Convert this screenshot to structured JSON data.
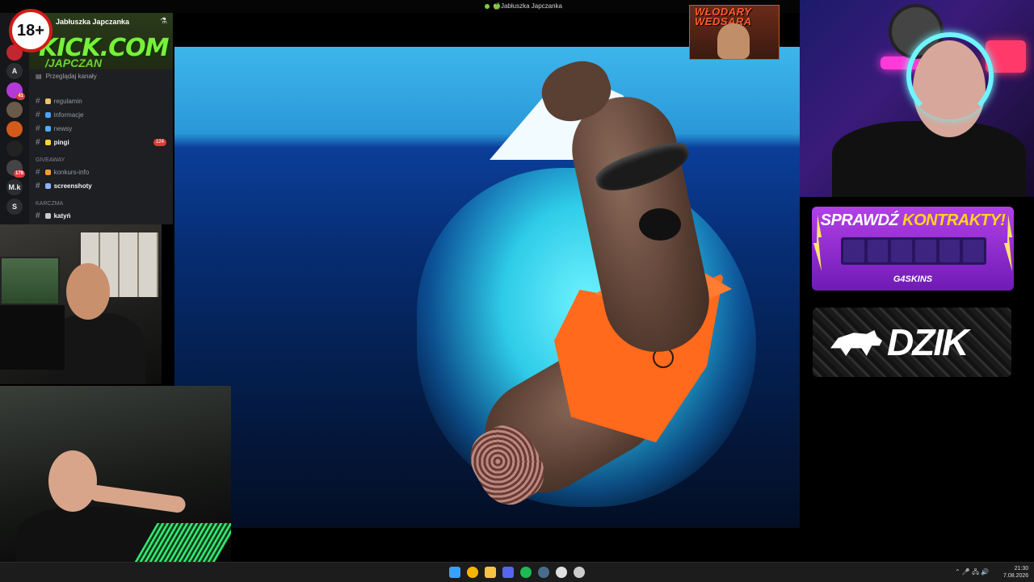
{
  "window": {
    "title": "🍏Jabłuszka Japczanka"
  },
  "age_badge": "18+",
  "discord": {
    "server_name": "Jabłuszka Japczanka",
    "banner_text": "KICK.COM",
    "banner_sub": "/JAPCZAN",
    "browse_label": "Przeglądaj kanały",
    "servers": [
      {
        "label": "",
        "icon": "pokeball-icon",
        "color": "#c2262e"
      },
      {
        "label": "A",
        "icon": "letter-avatar",
        "color": "#2b2d31"
      },
      {
        "label": "",
        "icon": "server-avatar",
        "color": "#b43ad8",
        "badge": "41"
      },
      {
        "label": "",
        "icon": "server-avatar",
        "color": "#6a5a4a"
      },
      {
        "label": "",
        "icon": "server-avatar",
        "color": "#d35a1a"
      },
      {
        "label": "",
        "icon": "server-avatar",
        "color": "#222"
      },
      {
        "label": "",
        "icon": "server-avatar",
        "color": "#444",
        "badge": "178"
      },
      {
        "label": "M.k",
        "icon": "letter-avatar",
        "color": "#2b2d31"
      },
      {
        "label": "S",
        "icon": "letter-avatar",
        "color": "#2b2d31"
      }
    ],
    "channels": [
      {
        "name": "regulamin",
        "emoji_color": "#e9c46a",
        "bold": false
      },
      {
        "name": "informacje",
        "emoji_color": "#4aa3ff",
        "bold": false
      },
      {
        "name": "newsy",
        "emoji_color": "#4ab0ff",
        "bold": false
      },
      {
        "name": "pingi",
        "emoji_color": "#ffd23a",
        "bold": true,
        "badge": "124"
      }
    ],
    "category_giveaway": "GIVEAWAY",
    "channels_giveaway": [
      {
        "name": "konkurs-info",
        "emoji_color": "#ff9b2e",
        "bold": false
      },
      {
        "name": "screenshoty",
        "emoji_color": "#8ab4ff",
        "bold": true
      }
    ],
    "category_karczma": "KARCZMA",
    "channels_karczma": [
      {
        "name": "katyń",
        "emoji_color": "#cccccc",
        "bold": true
      }
    ]
  },
  "overlays": {
    "emblem_text": "WŁODARY\nWEDSARA",
    "promo_title_main": "SPRAWDŹ ",
    "promo_title_accent": "KONTRAKTY!",
    "promo_brand": "G4SKINS",
    "dzik_text": "DZIK"
  },
  "taskbar": {
    "icons": [
      {
        "name": "windows-start-icon",
        "color": "#3aa0ff"
      },
      {
        "name": "chrome-icon",
        "color": "#f4b400"
      },
      {
        "name": "file-explorer-icon",
        "color": "#f5c542"
      },
      {
        "name": "discord-icon",
        "color": "#5865f2"
      },
      {
        "name": "spotify-icon",
        "color": "#1db954"
      },
      {
        "name": "steam-icon",
        "color": "#4a6c8c"
      },
      {
        "name": "browser-icon",
        "color": "#e0e0e0"
      },
      {
        "name": "settings-icon",
        "color": "#cccccc"
      }
    ],
    "tray_icons": "⌃  🎤  🖧  🔊",
    "time": "21:30",
    "date": "7.08.2026"
  }
}
